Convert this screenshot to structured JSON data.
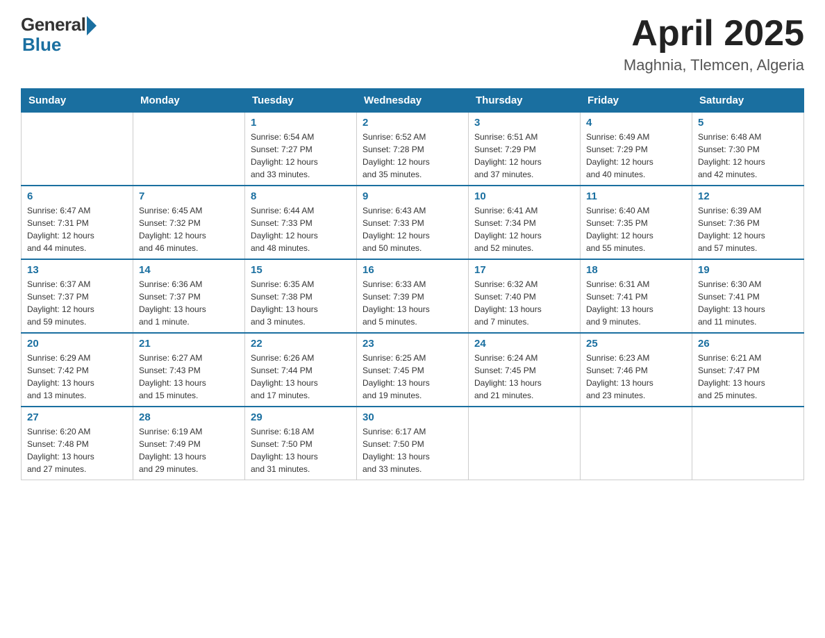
{
  "header": {
    "logo_general": "General",
    "logo_blue": "Blue",
    "title": "April 2025",
    "location": "Maghnia, Tlemcen, Algeria"
  },
  "weekdays": [
    "Sunday",
    "Monday",
    "Tuesday",
    "Wednesday",
    "Thursday",
    "Friday",
    "Saturday"
  ],
  "weeks": [
    [
      {
        "day": "",
        "info": ""
      },
      {
        "day": "",
        "info": ""
      },
      {
        "day": "1",
        "info": "Sunrise: 6:54 AM\nSunset: 7:27 PM\nDaylight: 12 hours\nand 33 minutes."
      },
      {
        "day": "2",
        "info": "Sunrise: 6:52 AM\nSunset: 7:28 PM\nDaylight: 12 hours\nand 35 minutes."
      },
      {
        "day": "3",
        "info": "Sunrise: 6:51 AM\nSunset: 7:29 PM\nDaylight: 12 hours\nand 37 minutes."
      },
      {
        "day": "4",
        "info": "Sunrise: 6:49 AM\nSunset: 7:29 PM\nDaylight: 12 hours\nand 40 minutes."
      },
      {
        "day": "5",
        "info": "Sunrise: 6:48 AM\nSunset: 7:30 PM\nDaylight: 12 hours\nand 42 minutes."
      }
    ],
    [
      {
        "day": "6",
        "info": "Sunrise: 6:47 AM\nSunset: 7:31 PM\nDaylight: 12 hours\nand 44 minutes."
      },
      {
        "day": "7",
        "info": "Sunrise: 6:45 AM\nSunset: 7:32 PM\nDaylight: 12 hours\nand 46 minutes."
      },
      {
        "day": "8",
        "info": "Sunrise: 6:44 AM\nSunset: 7:33 PM\nDaylight: 12 hours\nand 48 minutes."
      },
      {
        "day": "9",
        "info": "Sunrise: 6:43 AM\nSunset: 7:33 PM\nDaylight: 12 hours\nand 50 minutes."
      },
      {
        "day": "10",
        "info": "Sunrise: 6:41 AM\nSunset: 7:34 PM\nDaylight: 12 hours\nand 52 minutes."
      },
      {
        "day": "11",
        "info": "Sunrise: 6:40 AM\nSunset: 7:35 PM\nDaylight: 12 hours\nand 55 minutes."
      },
      {
        "day": "12",
        "info": "Sunrise: 6:39 AM\nSunset: 7:36 PM\nDaylight: 12 hours\nand 57 minutes."
      }
    ],
    [
      {
        "day": "13",
        "info": "Sunrise: 6:37 AM\nSunset: 7:37 PM\nDaylight: 12 hours\nand 59 minutes."
      },
      {
        "day": "14",
        "info": "Sunrise: 6:36 AM\nSunset: 7:37 PM\nDaylight: 13 hours\nand 1 minute."
      },
      {
        "day": "15",
        "info": "Sunrise: 6:35 AM\nSunset: 7:38 PM\nDaylight: 13 hours\nand 3 minutes."
      },
      {
        "day": "16",
        "info": "Sunrise: 6:33 AM\nSunset: 7:39 PM\nDaylight: 13 hours\nand 5 minutes."
      },
      {
        "day": "17",
        "info": "Sunrise: 6:32 AM\nSunset: 7:40 PM\nDaylight: 13 hours\nand 7 minutes."
      },
      {
        "day": "18",
        "info": "Sunrise: 6:31 AM\nSunset: 7:41 PM\nDaylight: 13 hours\nand 9 minutes."
      },
      {
        "day": "19",
        "info": "Sunrise: 6:30 AM\nSunset: 7:41 PM\nDaylight: 13 hours\nand 11 minutes."
      }
    ],
    [
      {
        "day": "20",
        "info": "Sunrise: 6:29 AM\nSunset: 7:42 PM\nDaylight: 13 hours\nand 13 minutes."
      },
      {
        "day": "21",
        "info": "Sunrise: 6:27 AM\nSunset: 7:43 PM\nDaylight: 13 hours\nand 15 minutes."
      },
      {
        "day": "22",
        "info": "Sunrise: 6:26 AM\nSunset: 7:44 PM\nDaylight: 13 hours\nand 17 minutes."
      },
      {
        "day": "23",
        "info": "Sunrise: 6:25 AM\nSunset: 7:45 PM\nDaylight: 13 hours\nand 19 minutes."
      },
      {
        "day": "24",
        "info": "Sunrise: 6:24 AM\nSunset: 7:45 PM\nDaylight: 13 hours\nand 21 minutes."
      },
      {
        "day": "25",
        "info": "Sunrise: 6:23 AM\nSunset: 7:46 PM\nDaylight: 13 hours\nand 23 minutes."
      },
      {
        "day": "26",
        "info": "Sunrise: 6:21 AM\nSunset: 7:47 PM\nDaylight: 13 hours\nand 25 minutes."
      }
    ],
    [
      {
        "day": "27",
        "info": "Sunrise: 6:20 AM\nSunset: 7:48 PM\nDaylight: 13 hours\nand 27 minutes."
      },
      {
        "day": "28",
        "info": "Sunrise: 6:19 AM\nSunset: 7:49 PM\nDaylight: 13 hours\nand 29 minutes."
      },
      {
        "day": "29",
        "info": "Sunrise: 6:18 AM\nSunset: 7:50 PM\nDaylight: 13 hours\nand 31 minutes."
      },
      {
        "day": "30",
        "info": "Sunrise: 6:17 AM\nSunset: 7:50 PM\nDaylight: 13 hours\nand 33 minutes."
      },
      {
        "day": "",
        "info": ""
      },
      {
        "day": "",
        "info": ""
      },
      {
        "day": "",
        "info": ""
      }
    ]
  ]
}
